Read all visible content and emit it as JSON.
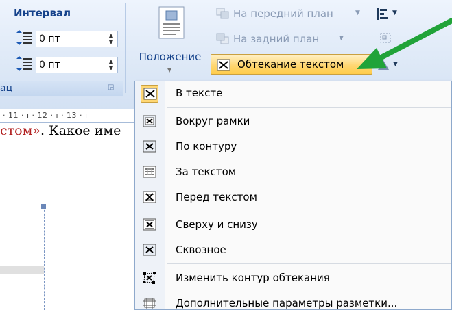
{
  "ribbon": {
    "interval": {
      "title": "Интервал",
      "before": "0 пт",
      "after": "0 пт"
    },
    "group_label": "ац",
    "position_label": "Положение",
    "bring_front": "На передний план",
    "send_back": "На задний план",
    "wrap_text": "Обтекание текстом"
  },
  "ruler": {
    "text": "· 11 · ı · 12 · ı · 13 · ı"
  },
  "document": {
    "red_text": "стом»",
    "black_text": ". Какое име"
  },
  "menu": {
    "items": [
      {
        "label": "В тексте"
      },
      {
        "label": "Вокруг рамки"
      },
      {
        "label": "По контуру"
      },
      {
        "label": "За текстом"
      },
      {
        "label": "Перед текстом"
      },
      {
        "label": "Сверху и снизу"
      },
      {
        "label": "Сквозное"
      },
      {
        "label": "Изменить контур обтекания"
      },
      {
        "label": "Дополнительные параметры разметки..."
      }
    ]
  },
  "colors": {
    "ribbon_text": "#15428b",
    "highlight": "#ffd773",
    "annotation_arrow": "#21a339"
  },
  "icons": [
    "line-spacing-icon",
    "position-icon",
    "bring-front-icon",
    "send-back-icon",
    "align-icon",
    "group-icon",
    "rotate-icon",
    "wrap-text-icon"
  ]
}
